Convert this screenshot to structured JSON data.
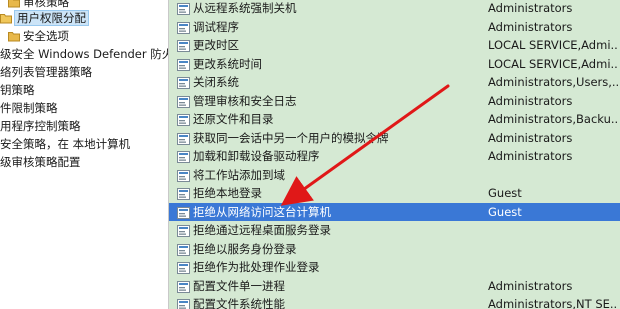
{
  "tree": {
    "items": [
      {
        "label": "审核策略",
        "icon": "folder-icon"
      },
      {
        "label": "用户权限分配",
        "icon": "folder-open-icon",
        "selected": true
      },
      {
        "label": "安全选项",
        "icon": "folder-icon"
      },
      {
        "label": "级安全 Windows Defender 防火墙",
        "icon": "none"
      },
      {
        "label": "络列表管理器策略",
        "icon": "none"
      },
      {
        "label": "钥策略",
        "icon": "none"
      },
      {
        "label": "件限制策略",
        "icon": "none"
      },
      {
        "label": "用程序控制策略",
        "icon": "none"
      },
      {
        "label": "安全策略，在 本地计算机",
        "icon": "none"
      },
      {
        "label": "级审核策略配置",
        "icon": "none"
      }
    ]
  },
  "policies": [
    {
      "policy": "从远程系统强制关机",
      "setting": "Administrators"
    },
    {
      "policy": "调试程序",
      "setting": "Administrators"
    },
    {
      "policy": "更改时区",
      "setting": "LOCAL SERVICE,Admi..."
    },
    {
      "policy": "更改系统时间",
      "setting": "LOCAL SERVICE,Admi..."
    },
    {
      "policy": "关闭系统",
      "setting": "Administrators,Users,..."
    },
    {
      "policy": "管理审核和安全日志",
      "setting": "Administrators"
    },
    {
      "policy": "还原文件和目录",
      "setting": "Administrators,Backu..."
    },
    {
      "policy": "获取同一会话中另一个用户的模拟令牌",
      "setting": "Administrators"
    },
    {
      "policy": "加载和卸载设备驱动程序",
      "setting": "Administrators"
    },
    {
      "policy": "将工作站添加到域",
      "setting": ""
    },
    {
      "policy": "拒绝本地登录",
      "setting": "Guest"
    },
    {
      "policy": "拒绝从网络访问这台计算机",
      "setting": "Guest",
      "selected": true
    },
    {
      "policy": "拒绝通过远程桌面服务登录",
      "setting": ""
    },
    {
      "policy": "拒绝以服务身份登录",
      "setting": ""
    },
    {
      "policy": "拒绝作为批处理作业登录",
      "setting": ""
    },
    {
      "policy": "配置文件单一进程",
      "setting": "Administrators"
    },
    {
      "policy": "配置文件系统性能",
      "setting": "Administrators,NT SE..."
    }
  ],
  "colors": {
    "list_background": "#d5e9d3",
    "selected_row": "#3a78d6",
    "arrow": "#e01818"
  },
  "row_icon": "policy-settings-icon",
  "annotation": "red-arrow-pointing-to-selected-policy"
}
